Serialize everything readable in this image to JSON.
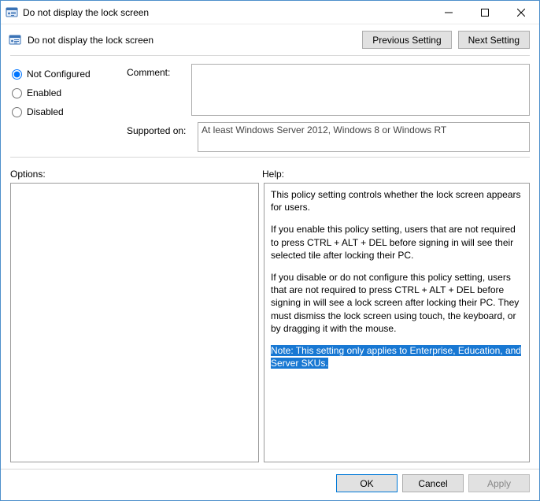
{
  "title": "Do not display the lock screen",
  "policy_name": "Do not display the lock screen",
  "buttons": {
    "previous": "Previous Setting",
    "next": "Next Setting",
    "ok": "OK",
    "cancel": "Cancel",
    "apply": "Apply"
  },
  "state": {
    "not_configured": "Not Configured",
    "enabled": "Enabled",
    "disabled": "Disabled",
    "selected": "not_configured"
  },
  "labels": {
    "comment": "Comment:",
    "supported_on": "Supported on:",
    "options": "Options:",
    "help": "Help:"
  },
  "comment_value": "",
  "supported_on_value": "At least Windows Server 2012, Windows 8 or Windows RT",
  "options_value": "",
  "help": {
    "p1": "This policy setting controls whether the lock screen appears for users.",
    "p2": "If you enable this policy setting, users that are not required to press CTRL + ALT + DEL before signing in will see their selected tile after locking their PC.",
    "p3": "If you disable or do not configure this policy setting, users that are not required to press CTRL + ALT + DEL before signing in will see a lock screen after locking their PC. They must dismiss the lock screen using touch, the keyboard, or by dragging it with the mouse.",
    "p4": "Note: This setting only applies to Enterprise, Education, and Server SKUs."
  }
}
